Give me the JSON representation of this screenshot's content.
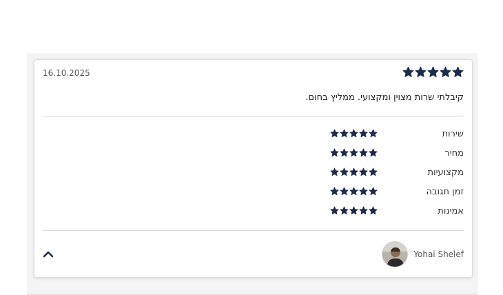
{
  "review": {
    "date": "16.10.2025",
    "overall_rating": 5,
    "max_rating": 5,
    "text": "קיבלתי שרות מצוין ומקצועי. ממליץ בחום.",
    "star_color": "#1c2b4a"
  },
  "ratings": [
    {
      "label": "שירות",
      "value": 5
    },
    {
      "label": "מחיר",
      "value": 5
    },
    {
      "label": "מקצועיות",
      "value": 5
    },
    {
      "label": "זמן תגובה",
      "value": 5
    },
    {
      "label": "אמינות",
      "value": 5
    }
  ],
  "author": {
    "name": "Yohai Shelef",
    "avatar_icon": "user-avatar"
  },
  "controls": {
    "collapse_icon": "chevron-up-icon"
  }
}
